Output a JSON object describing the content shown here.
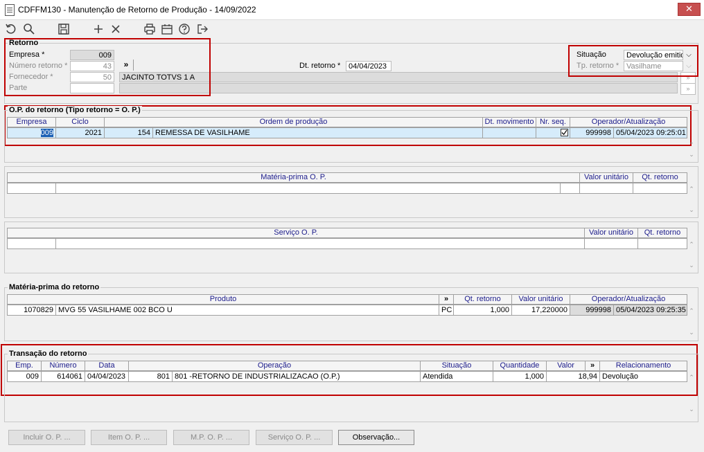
{
  "window": {
    "title": "CDFFM130 - Manutenção de Retorno de Produção - 14/09/2022",
    "close": "✕"
  },
  "retorno": {
    "group_label": "Retorno",
    "empresa_label": "Empresa *",
    "empresa_value": "009",
    "numero_label": "Número retorno *",
    "numero_value": "43",
    "fornecedor_label": "Fornecedor *",
    "fornecedor_value": "50",
    "fornecedor_nome": "JACINTO TOTVS 1 A",
    "parte_label": "Parte",
    "lookup_btn": "»",
    "dt_retorno_label": "Dt. retorno *",
    "dt_retorno_value": "04/04/2023",
    "situacao_label": "Situação",
    "situacao_value": "Devolução emitid",
    "tp_retorno_label": "Tp. retorno *",
    "tp_retorno_value": "Vasilhame"
  },
  "op": {
    "group_label": "O.P. do retorno (Tipo retorno = O. P.)",
    "headers": [
      "Empresa",
      "Ciclo",
      "Ordem de produção",
      "Dt. movimento",
      "Nr. seq.",
      "Operador/Atualização"
    ],
    "row": {
      "empresa": "009",
      "ciclo": "2021",
      "ordem_num": "154",
      "ordem_desc": "REMESSA DE VASILHAME",
      "dt_mov": "",
      "operador": "999998",
      "atualizacao": "05/04/2023 09:25:01"
    }
  },
  "mp_op": {
    "headers": [
      "Matéria-prima O. P.",
      "Valor unitário",
      "Qt. retorno"
    ]
  },
  "serv_op": {
    "headers": [
      "Serviço O. P.",
      "Valor unitário",
      "Qt. retorno"
    ]
  },
  "mp_ret": {
    "group_label": "Matéria-prima do retorno",
    "headers": [
      "Produto",
      "»",
      "Qt. retorno",
      "Valor unitário",
      "Operador/Atualização"
    ],
    "row": {
      "codigo": "1070829",
      "descricao": "MVG 55 VASILHAME 002 BCO U",
      "unidade": "PC",
      "qt": "1,000",
      "valor": "17,220000",
      "operador": "999998",
      "atualizacao": "05/04/2023 09:25:35"
    }
  },
  "trans": {
    "group_label": "Transação do retorno",
    "headers": [
      "Emp.",
      "Número",
      "Data",
      "Operação",
      "Situação",
      "Quantidade",
      "Valor",
      "»",
      "Relacionamento"
    ],
    "row": {
      "emp": "009",
      "numero": "614061",
      "data": "04/04/2023",
      "op_cod": "801",
      "op_desc": "801 -RETORNO DE INDUSTRIALIZACAO (O.P.)",
      "situacao": "Atendida",
      "quantidade": "1,000",
      "valor": "18,94",
      "relacionamento": "Devolução"
    }
  },
  "buttons": {
    "incluir_op": "Incluir O. P. ...",
    "item_op": "Item O. P. ...",
    "mpop": "M.P. O. P. ...",
    "servico_op": "Serviço O. P. ...",
    "observacao": "Observação..."
  },
  "colors": {
    "highlight_border": "#c00000",
    "header_text": "#1a1a8a",
    "selection": "#d6ecfb"
  }
}
